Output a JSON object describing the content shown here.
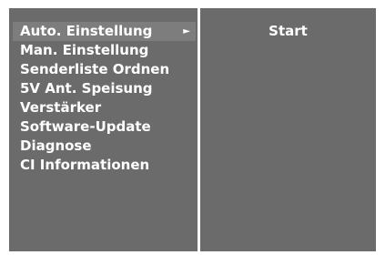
{
  "menu": {
    "items": [
      {
        "label": "Auto. Einstellung",
        "selected": true,
        "arrow": "►"
      },
      {
        "label": "Man. Einstellung"
      },
      {
        "label": "Senderliste Ordnen"
      },
      {
        "label": "5V Ant. Speisung"
      },
      {
        "label": "Verstärker"
      },
      {
        "label": "Software-Update"
      },
      {
        "label": "Diagnose"
      },
      {
        "label": "CI Informationen"
      }
    ]
  },
  "submenu": {
    "items": [
      {
        "label": "Start"
      }
    ]
  },
  "colors": {
    "panel": "#6b6b6b",
    "highlight": "#7d7d7d",
    "text": "#ffffff",
    "divider": "#ffffff"
  },
  "icons": {
    "submenu_arrow": "triangle-right-icon"
  }
}
